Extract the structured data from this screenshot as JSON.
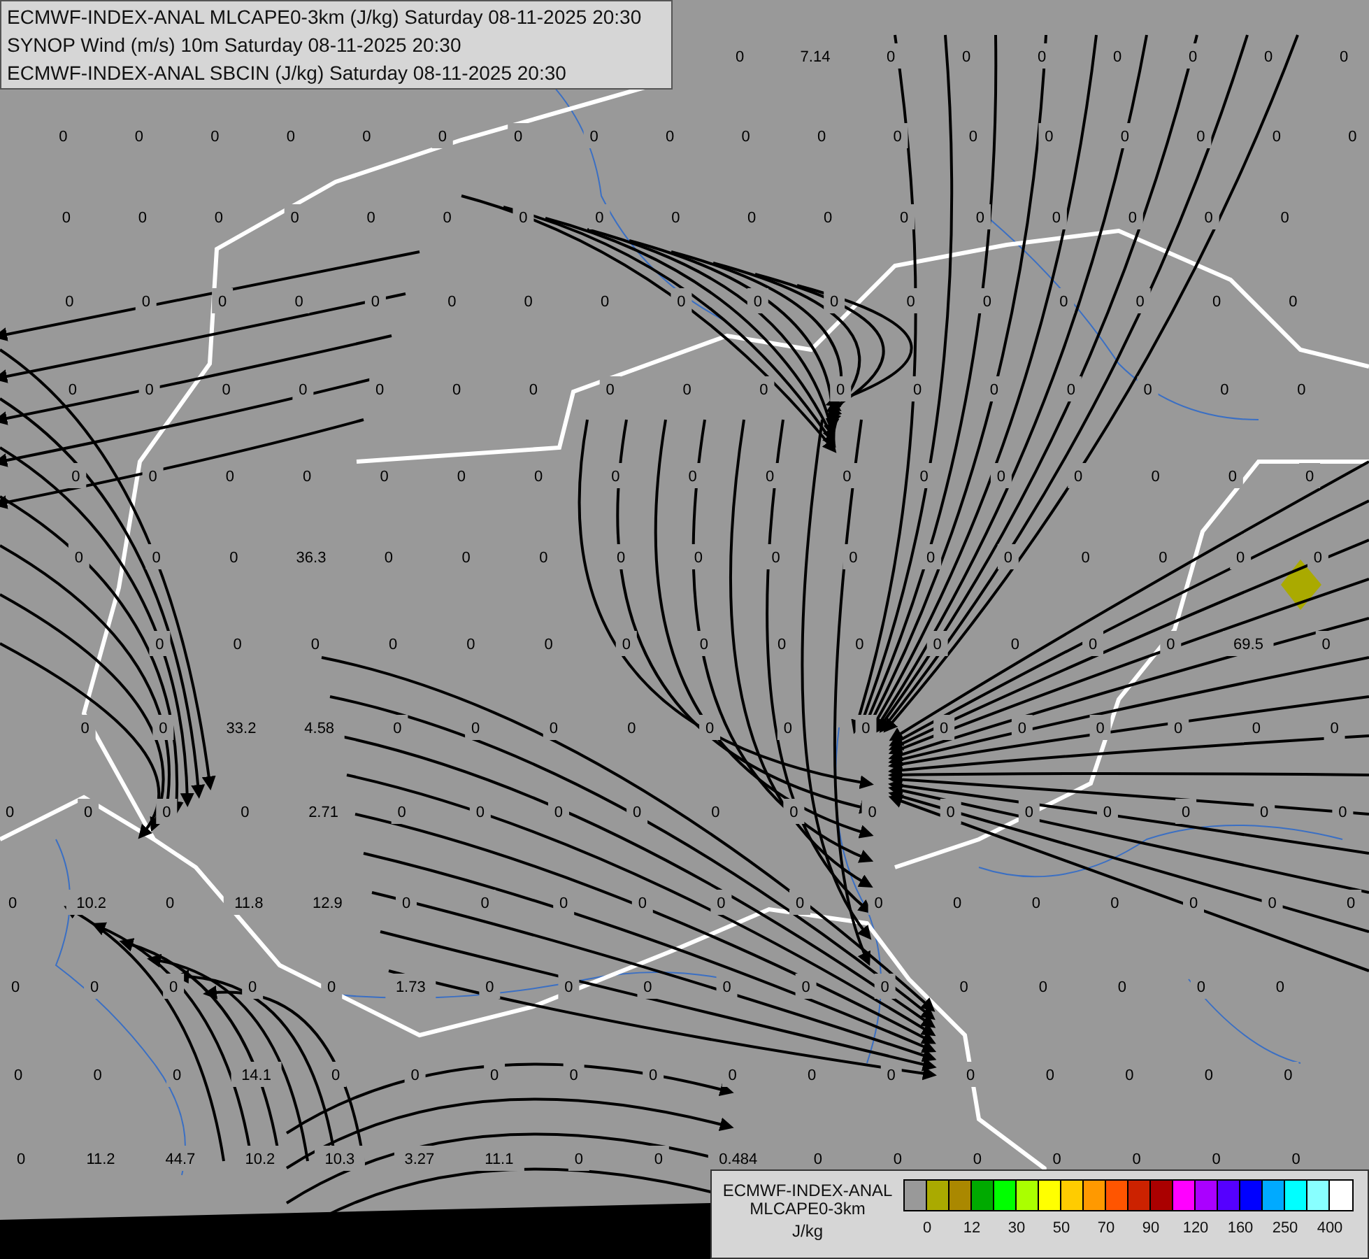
{
  "header": {
    "lines": [
      "ECMWF-INDEX-ANAL MLCAPE0-3km (J/kg) Saturday 08-11-2025 20:30",
      "SYNOP Wind (m/s) 10m Saturday 08-11-2025 20:30",
      "ECMWF-INDEX-ANAL SBCIN (J/kg) Saturday 08-11-2025 20:30"
    ]
  },
  "map": {
    "value_grid": [
      [
        "0",
        "7.14",
        "0",
        "0",
        "0",
        "0",
        "0",
        "0",
        "0"
      ],
      [
        "0",
        "0",
        "0",
        "0",
        "0",
        "0",
        "0",
        "0",
        "0",
        "0",
        "0",
        "0",
        "0",
        "0",
        "0",
        "0",
        "0",
        "0"
      ],
      [
        "0",
        "0",
        "0",
        "0",
        "0",
        "0",
        "0",
        "0",
        "0",
        "0",
        "0",
        "0",
        "0",
        "0",
        "0",
        "0",
        "0"
      ],
      [
        "0",
        "0",
        "0",
        "0",
        "0",
        "0",
        "0",
        "0",
        "0",
        "0",
        "0",
        "0",
        "0",
        "0",
        "0",
        "0",
        "0"
      ],
      [
        "0",
        "0",
        "0",
        "0",
        "0",
        "0",
        "0",
        "0",
        "0",
        "0",
        "0",
        "0",
        "0",
        "0",
        "0",
        "0",
        "0"
      ],
      [
        "0",
        "0",
        "0",
        "0",
        "0",
        "0",
        "0",
        "0",
        "0",
        "0",
        "0",
        "0",
        "0",
        "0",
        "0",
        "0",
        "0"
      ],
      [
        "0",
        "0",
        "0",
        "36.3",
        "0",
        "0",
        "0",
        "0",
        "0",
        "0",
        "0",
        "0",
        "0",
        "0",
        "0",
        "0",
        "0"
      ],
      [
        "0",
        "0",
        "0",
        "0",
        "0",
        "0",
        "0",
        "0",
        "0",
        "0",
        "0",
        "0",
        "0",
        "0",
        "69.5",
        "0"
      ],
      [
        "0",
        "0",
        "33.2",
        "4.58",
        "0",
        "0",
        "0",
        "0",
        "0",
        "0",
        "0",
        "0",
        "0",
        "0",
        "0",
        "0",
        "0"
      ],
      [
        "0",
        "0",
        "0",
        "0",
        "2.71",
        "0",
        "0",
        "0",
        "0",
        "0",
        "0",
        "0",
        "0",
        "0",
        "0",
        "0",
        "0",
        "0"
      ],
      [
        "0",
        "10.2",
        "0",
        "11.8",
        "12.9",
        "0",
        "0",
        "0",
        "0",
        "0",
        "0",
        "0",
        "0",
        "0",
        "0",
        "0",
        "0",
        "0"
      ],
      [
        "0",
        "0",
        "0",
        "0",
        "0",
        "1.73",
        "0",
        "0",
        "0",
        "0",
        "0",
        "0",
        "0",
        "0",
        "0",
        "0",
        "0"
      ],
      [
        "0",
        "0",
        "0",
        "14.1",
        "0",
        "0",
        "0",
        "0",
        "0",
        "0",
        "0",
        "0",
        "0",
        "0",
        "0",
        "0",
        "0"
      ],
      [
        "0",
        "11.2",
        "44.7",
        "10.2",
        "10.3",
        "3.27",
        "11.1",
        "0",
        "0",
        "0.484",
        "0",
        "0",
        "0",
        "0",
        "0",
        "0",
        "0"
      ]
    ]
  },
  "legend": {
    "title_lines": [
      "ECMWF-INDEX-ANAL",
      "MLCAPE0-3km"
    ],
    "unit": "J/kg",
    "swatches": [
      {
        "color": "#999999"
      },
      {
        "color": "#aaaa00"
      },
      {
        "color": "#aa8800"
      },
      {
        "color": "#00aa00"
      },
      {
        "color": "#00ff00"
      },
      {
        "color": "#aaff00"
      },
      {
        "color": "#ffff00"
      },
      {
        "color": "#ffcc00"
      },
      {
        "color": "#ff9900"
      },
      {
        "color": "#ff5500"
      },
      {
        "color": "#cc2200"
      },
      {
        "color": "#aa0000"
      },
      {
        "color": "#ff00ff"
      },
      {
        "color": "#aa00ff"
      },
      {
        "color": "#5500ff"
      },
      {
        "color": "#0000ff"
      },
      {
        "color": "#00aaff"
      },
      {
        "color": "#00ffff"
      },
      {
        "color": "#88ffff"
      },
      {
        "color": "#ffffff"
      }
    ],
    "ticks": [
      "0",
      "12",
      "30",
      "50",
      "70",
      "90",
      "120",
      "160",
      "250",
      "400"
    ]
  }
}
